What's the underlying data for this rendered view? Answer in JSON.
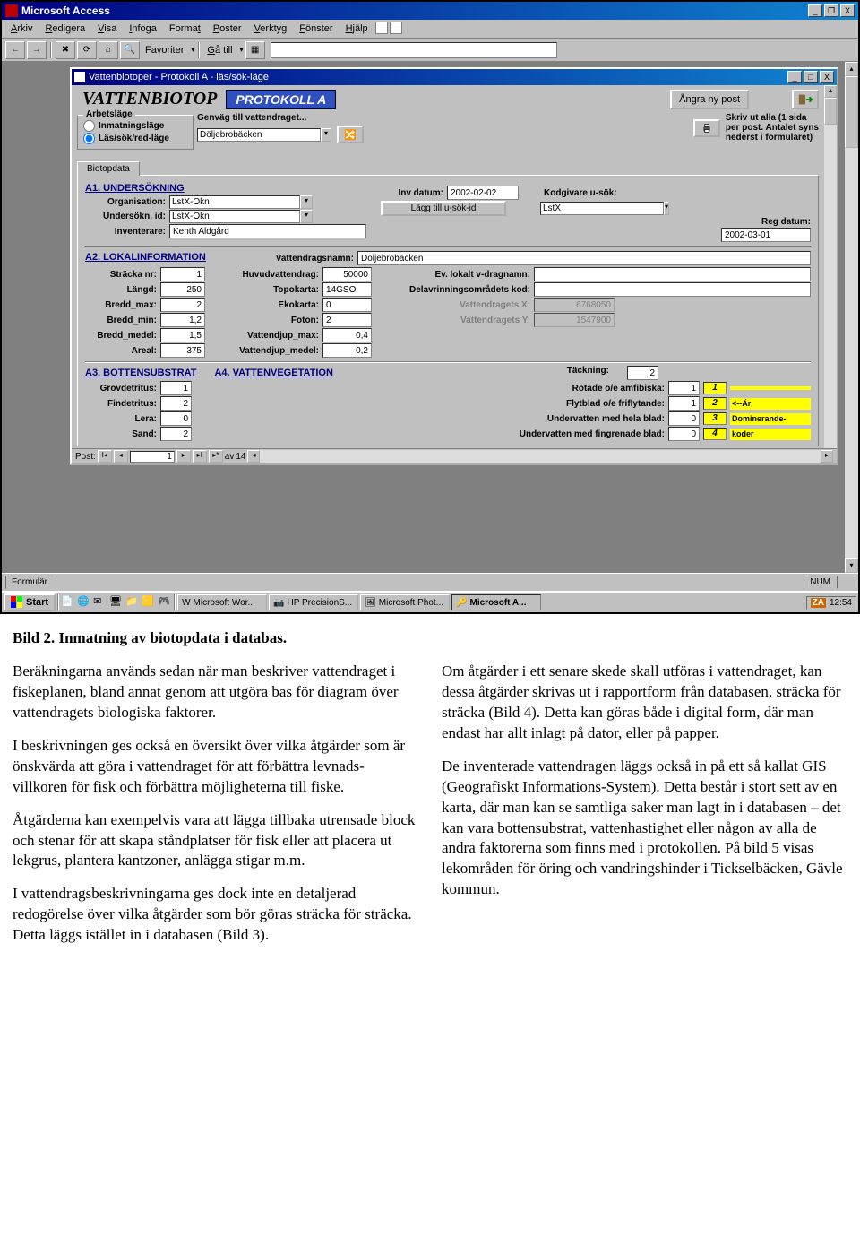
{
  "app": {
    "title": "Microsoft Access",
    "menu": [
      "Arkiv",
      "Redigera",
      "Visa",
      "Infoga",
      "Format",
      "Poster",
      "Verktyg",
      "Fönster",
      "Hjälp"
    ],
    "favoriter_label": "Favoriter",
    "gatill_label": "Gå till"
  },
  "inner_window": {
    "title": "Vattenbiotoper - Protokoll A - läs/sök-läge"
  },
  "form": {
    "big_title": "VATTENBIOTOP",
    "protokoll_badge": "PROTOKOLL A",
    "angra_label": "Ångra ny post",
    "arbetslage_legend": "Arbetsläge",
    "radio1": "Inmatningsläge",
    "radio2": "Läs/sök/red-läge",
    "genvag_label": "Genväg till vattendraget...",
    "genvag_value": "Döljebrobäcken",
    "skrivut_text_l1": "Skriv ut alla (1 sida",
    "skrivut_text_l2": "per post. Antalet syns",
    "skrivut_text_l3": "nederst i formuläret)",
    "tab_label": "Biotopdata"
  },
  "a1": {
    "header": "A1. UNDERSÖKNING",
    "organisation_label": "Organisation:",
    "organisation": "LstX-Okn",
    "undersokn_id_label": "Undersökn. id:",
    "undersokn_id": "LstX-Okn",
    "inventerare_label": "Inventerare:",
    "inventerare": "Kenth Aldgård",
    "inv_datum_label": "Inv datum:",
    "inv_datum": "2002-02-02",
    "lagg_till_btn": "Lägg till u-sök-id",
    "kodgivare_label": "Kodgivare u-sök:",
    "kodgivare": "LstX",
    "reg_datum_label": "Reg datum:",
    "reg_datum": "2002-03-01"
  },
  "a2": {
    "header": "A2. LOKALINFORMATION",
    "stracka_label": "Sträcka nr:",
    "stracka": "1",
    "huvud_label": "Huvudvattendrag:",
    "huvud": "50000",
    "vattendragsnamn_label": "Vattendragsnamn:",
    "vattendragsnamn": "Döljebrobäcken",
    "ev_lokalt_label": "Ev. lokalt v-dragnamn:",
    "ev_lokalt": "",
    "langd_label": "Längd:",
    "langd": "250",
    "topokarta_label": "Topokarta:",
    "topokarta": "14GSO",
    "delavr_label": "Delavrinningsområdets kod:",
    "delavr": "",
    "bredd_max_label": "Bredd_max:",
    "bredd_max": "2",
    "ekokarta_label": "Ekokarta:",
    "ekokarta": "0",
    "vdx_label": "Vattendragets X:",
    "vdx": "6768050",
    "bredd_min_label": "Bredd_min:",
    "bredd_min": "1,2",
    "foton_label": "Foton:",
    "foton": "2",
    "vdy_label": "Vattendragets Y:",
    "vdy": "1547900",
    "bredd_medel_label": "Bredd_medel:",
    "bredd_medel": "1,5",
    "vdjup_max_label": "Vattendjup_max:",
    "vdjup_max": "0,4",
    "areal_label": "Areal:",
    "areal": "375",
    "vdjup_medel_label": "Vattendjup_medel:",
    "vdjup_medel": "0,2"
  },
  "a3": {
    "header_a3": "A3. BOTTENSUBSTRAT",
    "header_a4": "A4. VATTENVEGETATION",
    "tackning_label": "Täckning:",
    "tackning": "2",
    "grovdetritus_label": "Grovdetritus:",
    "grovdetritus": "1",
    "rotade_label": "Rotade o/e amfibiska:",
    "rotade": "1",
    "findetritus_label": "Findetritus:",
    "findetritus": "2",
    "flytblad_label": "Flytblad o/e friflytande:",
    "flytblad": "1",
    "lera_label": "Lera:",
    "lera": "0",
    "undervatten_hela_label": "Undervatten med hela blad:",
    "undervatten_hela": "0",
    "sand_label": "Sand:",
    "sand": "2",
    "undervatten_fingr_label": "Undervatten med fingrenade blad:",
    "undervatten_fingr": "0",
    "dom_note_l1": "<--Är",
    "dom_note_l2": "Dominerande-",
    "dom_note_l3": "koder",
    "dom1": "1",
    "dom2": "2",
    "dom3": "3",
    "dom4": "4"
  },
  "recnav": {
    "post_label": "Post:",
    "current": "1",
    "av": "av",
    "total": "14"
  },
  "statusbar": {
    "left": "Formulär",
    "num": "NUM"
  },
  "taskbar": {
    "start": "Start",
    "tasks": [
      "Microsoft Wor...",
      "HP PrecisionS...",
      "Microsoft Phot...",
      "Microsoft A..."
    ],
    "clock_lang": "ZA",
    "clock": "12:54"
  },
  "doc": {
    "caption": "Bild 2. Inmatning av biotopdata i databas.",
    "left": [
      "Beräkningarna används sedan när man beskriver vattendraget i fiskeplanen, bland annat genom att utgöra bas för diagram över vattendragets biologiska faktorer.",
      "I beskrivningen ges också en översikt över vilka åtgärder som är önskvärda att göra i vattendraget för att förbättra levnads-villkoren för fisk och förbättra möjligheterna till fiske.",
      "Åtgärderna kan exempelvis vara att lägga tillbaka utrensade block och stenar för att skapa ståndplatser för fisk eller att placera ut lekgrus, plantera kantzoner, anlägga stigar m.m.",
      "I vattendragsbeskrivningarna ges dock inte en detaljerad redogörelse över vilka åtgärder som bör göras sträcka för sträcka. Detta läggs istället in i databasen (Bild 3)."
    ],
    "right": [
      "Om åtgärder i ett senare skede skall utföras i vattendraget, kan dessa åtgärder skrivas ut i rapportform från databasen, sträcka för sträcka (Bild 4). Detta kan göras både i digital form, där man endast har allt inlagt på dator, eller på papper.",
      "De inventerade vattendragen läggs också in på ett så kallat GIS (Geografiskt Informations-System). Detta består i stort sett av en karta, där man kan se samtliga saker man lagt in i databasen – det kan vara bottensubstrat, vattenhastighet eller någon av alla de andra faktorerna som finns med i protokollen. På bild 5 visas lekområden för öring och vandringshinder i Tickselbäcken, Gävle kommun."
    ]
  }
}
